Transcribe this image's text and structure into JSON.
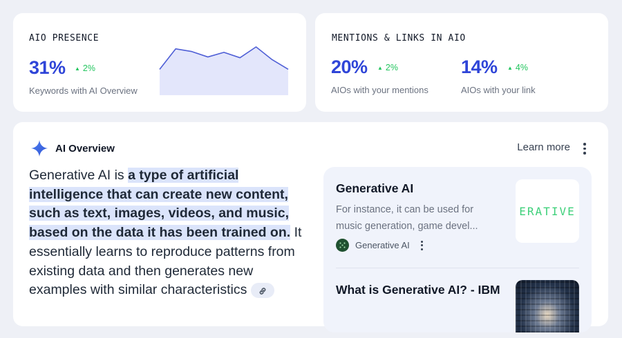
{
  "aio_presence": {
    "title": "AIO PRESENCE",
    "value": "31%",
    "delta": "2%",
    "caption": "Keywords with AI Overview",
    "sparkline": [
      0.42,
      0.95,
      0.88,
      0.74,
      0.86,
      0.72,
      1.0,
      0.67,
      0.42
    ]
  },
  "mentions": {
    "title": "MENTIONS & LINKS IN AIO",
    "metrics": [
      {
        "value": "20%",
        "delta": "2%",
        "caption": "AIOs with your mentions"
      },
      {
        "value": "14%",
        "delta": "4%",
        "caption": "AIOs with your link"
      }
    ]
  },
  "overview": {
    "label": "AI Overview",
    "learn_more": "Learn more",
    "text_plain_before": "Generative AI is ",
    "text_highlight": "a type of artificial intelligence that can create new content, such as text, images, videos, and music, based on the data it has been trained on.",
    "text_plain_after": " It essentially learns to reproduce patterns from existing data and then generates new examples with similar characteristics",
    "sources": [
      {
        "title": "Generative AI",
        "snippet": "For instance, it can be used for music generation, game devel...",
        "site": "Generative AI",
        "thumb_text": "ERATIVE"
      },
      {
        "title": "What is Generative AI? - IBM"
      }
    ]
  },
  "colors": {
    "accent_blue": "#2f45d8",
    "positive_green": "#22c55e",
    "highlight": "#dbe4fb"
  }
}
